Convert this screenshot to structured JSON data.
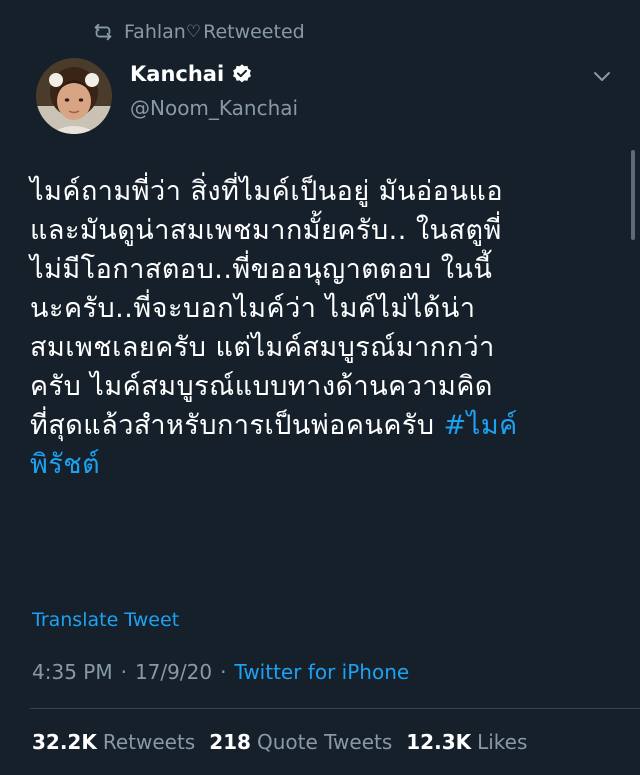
{
  "retweet_bar": {
    "icon": "retweet-icon",
    "user": "Fahlan",
    "heart": "♡",
    "label": "Retweeted"
  },
  "author": {
    "name": "Kanchai",
    "handle": "@Noom_Kanchai",
    "verified_icon": "verified-badge-icon"
  },
  "tweet": {
    "text": "ไมค์ถามพี่ว่า สิ่งที่ไมค์เป็นอยู่ มันอ่อนแอ\nและมันดูน่าสมเพชมากมั้ยครับ.. ในสตูพี่\nไม่มีโอกาสตอบ..พี่ขออนุญาตตอบ ในนี้\nนะครับ..พี่จะบอกไมค์ว่า ไมค์ไม่ได้น่า\nสมเพชเลยครับ แต่ไมค์สมบูรณ์มากกว่า\nครับ ไมค์สมบูรณ์แบบทางด้านความคิด\nที่สุดแล้วสำหรับการเป็นพ่อคนครับ ",
    "hashtag": "#ไมค์\nพิรัชต์"
  },
  "translate_label": "Translate Tweet",
  "meta": {
    "time": "4:35 PM",
    "separator": "·",
    "date": "17/9/20",
    "source": "Twitter for iPhone"
  },
  "stats": {
    "retweets_count": "32.2K",
    "retweets_label": "Retweets",
    "quotes_count": "218",
    "quotes_label": "Quote Tweets",
    "likes_count": "12.3K",
    "likes_label": "Likes"
  },
  "colors": {
    "background": "#15202b",
    "accent": "#1da1f2",
    "secondary_text": "#8899a6"
  }
}
